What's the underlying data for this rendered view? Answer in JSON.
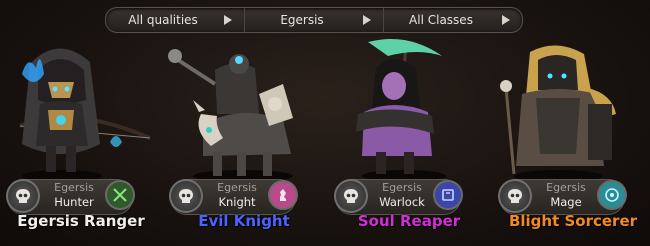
{
  "filters": {
    "quality": "All qualities",
    "faction": "Egersis",
    "class": "All Classes"
  },
  "heroes": [
    {
      "name": "Egersis Ranger",
      "faction": "Egersis",
      "class": "Hunter",
      "name_color": "#f2efea",
      "class_icon": "crossed-arrows-icon",
      "class_icon_color": "#3f7a3a"
    },
    {
      "name": "Evil Knight",
      "faction": "Egersis",
      "class": "Knight",
      "name_color": "#4c63ff",
      "class_icon": "knight-chess-icon",
      "class_icon_color": "#b94a8a"
    },
    {
      "name": "Soul Reaper",
      "faction": "Egersis",
      "class": "Warlock",
      "name_color": "#cf2fd6",
      "class_icon": "spellbook-icon",
      "class_icon_color": "#3a47a8"
    },
    {
      "name": "Blight Sorcerer",
      "faction": "Egersis",
      "class": "Mage",
      "name_color": "#f28a21",
      "class_icon": "question-orb-icon",
      "class_icon_color": "#2a8c94"
    }
  ],
  "faction_icon": "skull-icon"
}
